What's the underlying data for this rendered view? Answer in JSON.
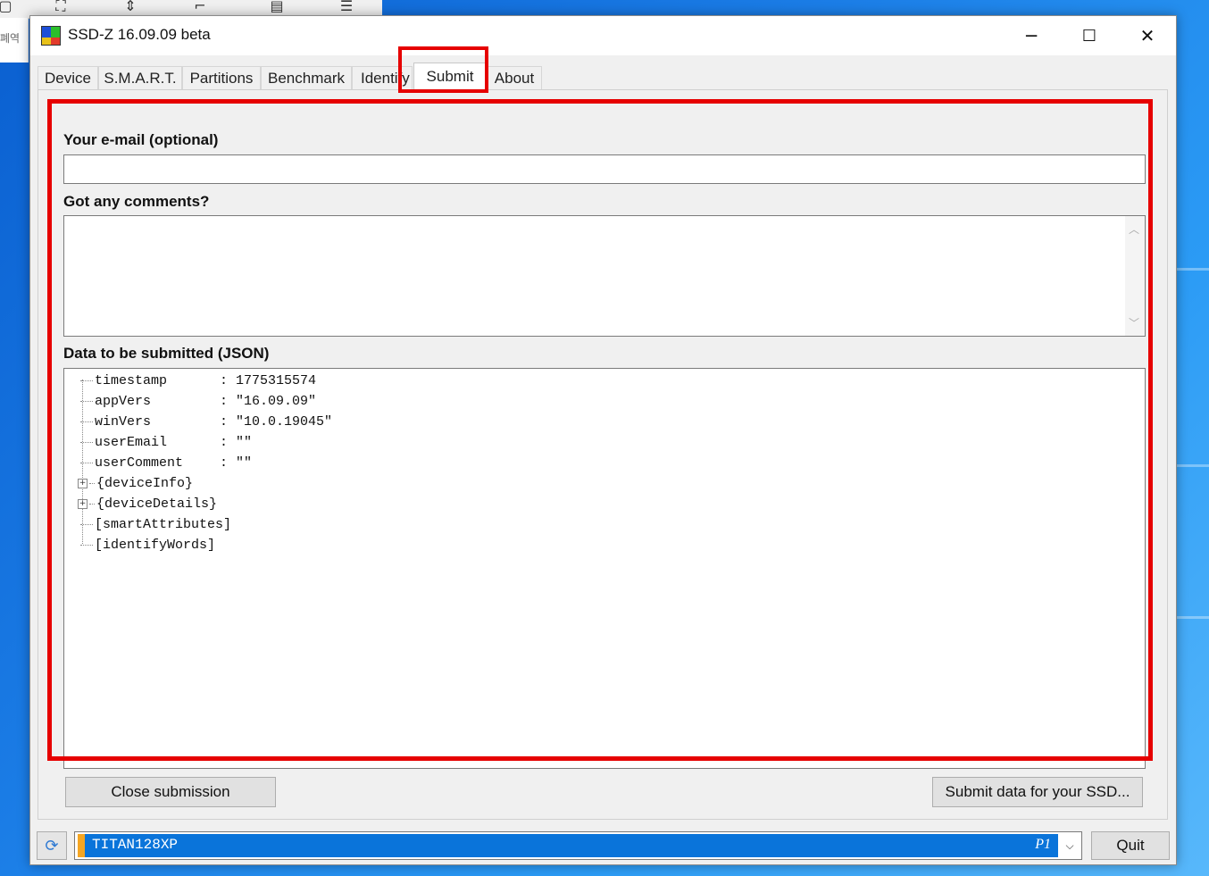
{
  "background": {
    "side_text": "폐역"
  },
  "window": {
    "title": "SSD-Z 16.09.09 beta",
    "controls": {
      "minimize": "─",
      "maximize": "☐",
      "close": "✕"
    }
  },
  "tabs": [
    {
      "label": "Device"
    },
    {
      "label": "S.M.A.R.T."
    },
    {
      "label": "Partitions"
    },
    {
      "label": "Benchmark"
    },
    {
      "label": "Identify"
    },
    {
      "label": "Submit",
      "active": true
    },
    {
      "label": "About"
    }
  ],
  "form": {
    "email_label": "Your e-mail (optional)",
    "email_value": "",
    "comments_label": "Got any comments?",
    "comments_value": "",
    "json_label": "Data to be submitted (JSON)"
  },
  "json_tree": [
    {
      "key": "timestamp",
      "sep": ":",
      "value": "1775315574"
    },
    {
      "key": "appVers",
      "sep": ":",
      "value": "\"16.09.09\""
    },
    {
      "key": "winVers",
      "sep": ":",
      "value": "\"10.0.19045\""
    },
    {
      "key": "userEmail",
      "sep": ":",
      "value": "\"\""
    },
    {
      "key": "userComment",
      "sep": ":",
      "value": "\"\""
    },
    {
      "key": "{deviceInfo}",
      "expandable": true,
      "expand_symbol": "+"
    },
    {
      "key": "{deviceDetails}",
      "expandable": true,
      "expand_symbol": "+"
    },
    {
      "key": "[smartAttributes]"
    },
    {
      "key": "[identifyWords]"
    }
  ],
  "buttons": {
    "close_submission": "Close submission",
    "submit_data": "Submit data for your SSD..."
  },
  "bottom_bar": {
    "device_name": "TITAN128XP",
    "device_partition": "P1",
    "quit": "Quit"
  },
  "colors": {
    "highlight": "#e60000",
    "selection": "#0a74da",
    "selection_accent": "#f5a623"
  }
}
